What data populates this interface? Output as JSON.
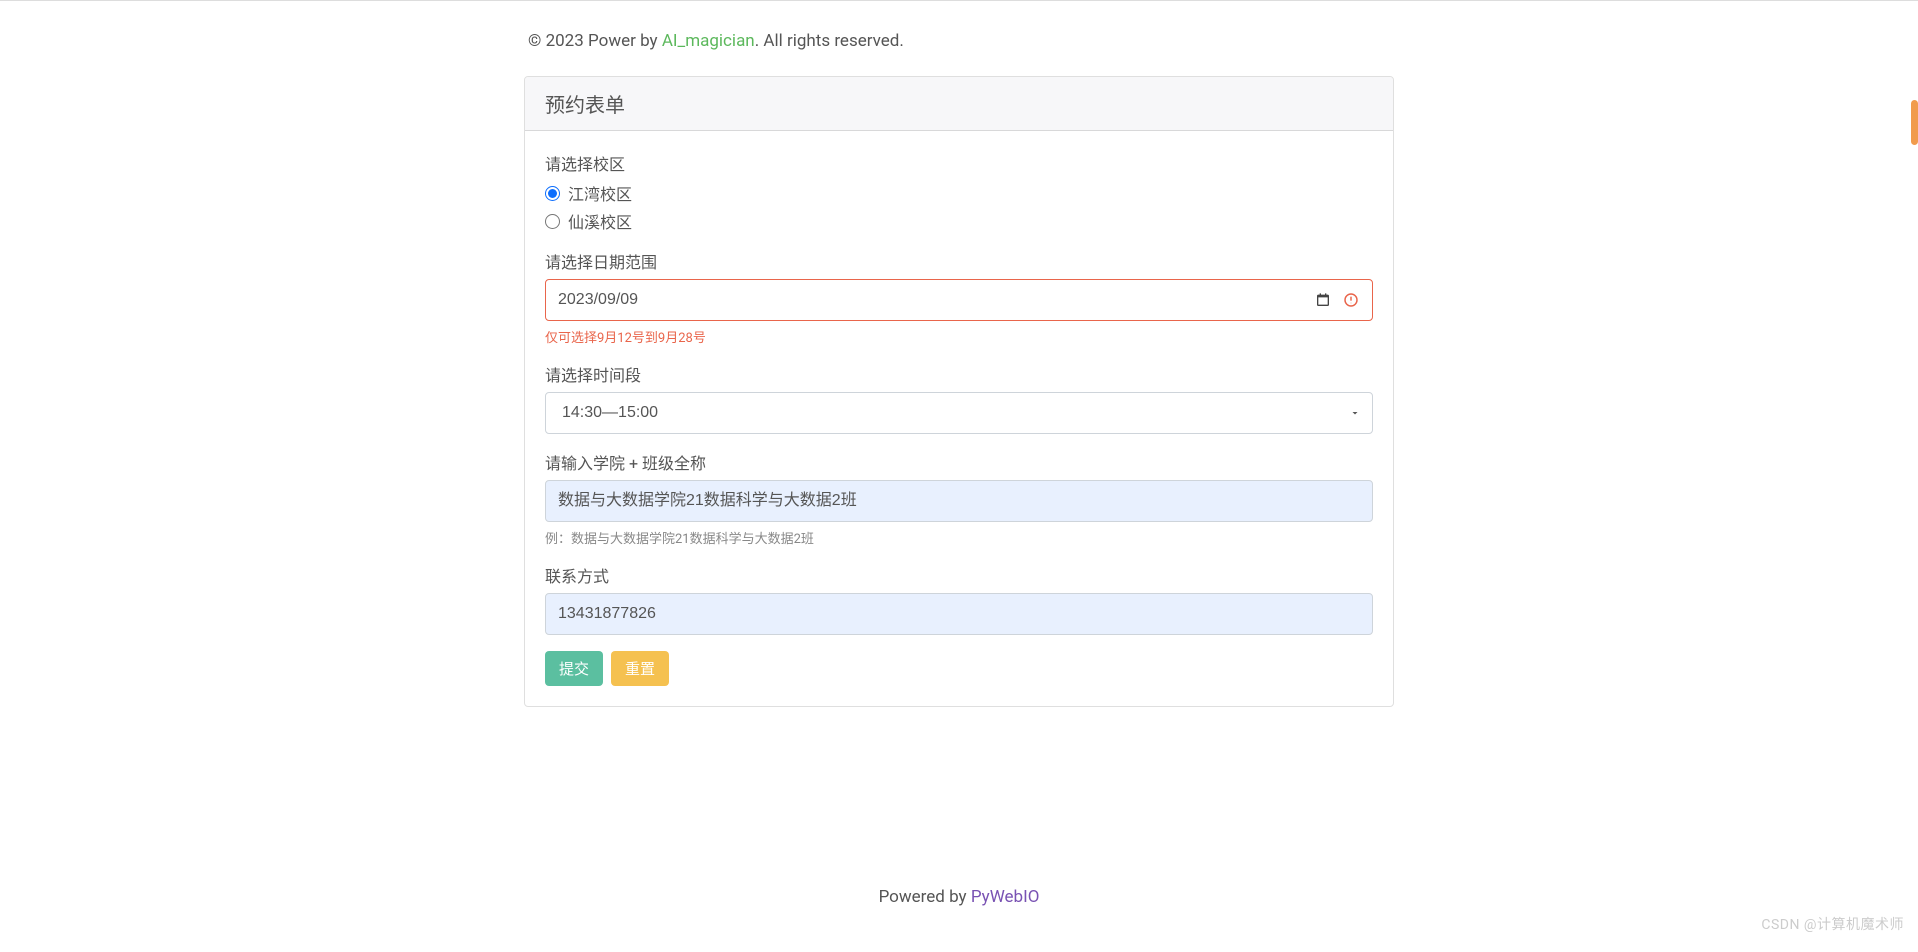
{
  "copyright": {
    "prefix": "© 2023 Power by ",
    "link_text": "AI_magician",
    "suffix": ". All rights reserved."
  },
  "card": {
    "title": "预约表单"
  },
  "campus": {
    "label": "请选择校区",
    "options": [
      {
        "label": "江湾校区",
        "checked": true
      },
      {
        "label": "仙溪校区",
        "checked": false
      }
    ]
  },
  "date": {
    "label": "请选择日期范围",
    "value": "2023/09/09",
    "error": "仅可选择9月12号到9月28号"
  },
  "time": {
    "label": "请选择时间段",
    "selected": "14:30—15:00"
  },
  "classinfo": {
    "label": "请输入学院 + 班级全称",
    "value": "数据与大数据学院21数据科学与大数据2班",
    "help": "例：数据与大数据学院21数据科学与大数据2班"
  },
  "contact": {
    "label": "联系方式",
    "value": "13431877826"
  },
  "buttons": {
    "submit": "提交",
    "reset": "重置"
  },
  "footer": {
    "prefix": "Powered by ",
    "link_text": "PyWebIO"
  },
  "watermark": "CSDN @计算机魔术师"
}
